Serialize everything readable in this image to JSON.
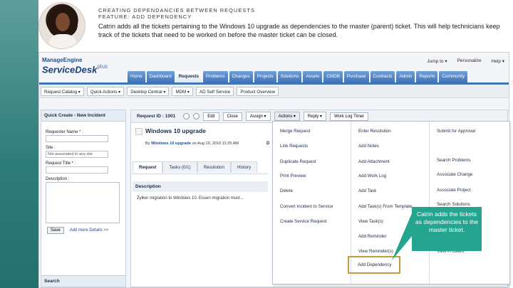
{
  "slide": {
    "kicker": "CREATING DEPENDANCIES BETWEEN REQUESTS",
    "feature": "FEATURE: ADD DEPENDENCY",
    "description": "Catrin adds all the tickets pertaining to the Windows 10 upgrade as dependencies to the master (parent) ticket. This will help technicians keep track of the tickets that need to be worked on before the master ticket can be closed.",
    "callout": "Catrin adds the tickets as dependencies to the master ticket."
  },
  "app": {
    "logo_top": "ManageEngine",
    "logo_main": "ServiceDesk",
    "logo_plus": "plus",
    "top_links": [
      "Jump to ▾",
      "Personalize",
      "Help ▾"
    ],
    "nav_tabs": [
      "Home",
      "Dashboard",
      "Requests",
      "Problems",
      "Changes",
      "Projects",
      "Solutions",
      "Assets",
      "CMDB",
      "Purchase",
      "Contracts",
      "Admin",
      "Reports",
      "Community"
    ],
    "active_tab": "Requests",
    "toolbar": [
      "Request Catalog ▾",
      "Quick Actions ▾",
      "Desktop Central ▾",
      "MDM ▾",
      "AD Self Service",
      "Product Overview"
    ]
  },
  "quick_create": {
    "title": "Quick Create - New Incident",
    "requester_label": "Requester Name * :",
    "site_label": "Site :",
    "site_value": "Not associated to any site",
    "title_label": "Request Title * :",
    "description_label": "Description :",
    "save": "Save",
    "more": "Add more Details >>",
    "search": "Search"
  },
  "request": {
    "id": "Request ID : 1001",
    "buttons": [
      "Edit",
      "Close",
      "Assign ▾",
      "Actions ▾",
      "Reply ▾",
      "Work Log Timer"
    ],
    "subject": "Windows 10 upgrade",
    "by_label": "By",
    "by_user": "Windows 10 upgrade",
    "date": "on Aug 19, 2016 11:25 AM",
    "d_char": "D",
    "tabs": [
      "Request",
      "Tasks (0/1)",
      "Resolution",
      "History"
    ],
    "desc_head": "Description",
    "desc_body": "Zylker migration to Windows 10. Essen migration must..."
  },
  "actions_menu": {
    "col1": [
      "Merge Request",
      "Link Requests",
      "Duplicate Request",
      "Print Preview",
      "Delete",
      "Convert Incident to Service",
      "Create Service Request"
    ],
    "col2": [
      "Enter Resolution",
      "Add Notes",
      "Add Attachment",
      "Add Work Log",
      "Add Task",
      "Add Task(s) From Template",
      "View Task(s)",
      "Add Reminder",
      "View Reminder(s)",
      "Add Dependency"
    ],
    "col3": [
      "Submit for Approval",
      "Search Problems",
      "Associate Change",
      "Associate Project",
      "Search Solutions",
      "View Problem"
    ]
  },
  "colors": {
    "accent": "#25a58f",
    "highlight_border": "#c59d3f",
    "nav_blue": "#3f74b9"
  }
}
